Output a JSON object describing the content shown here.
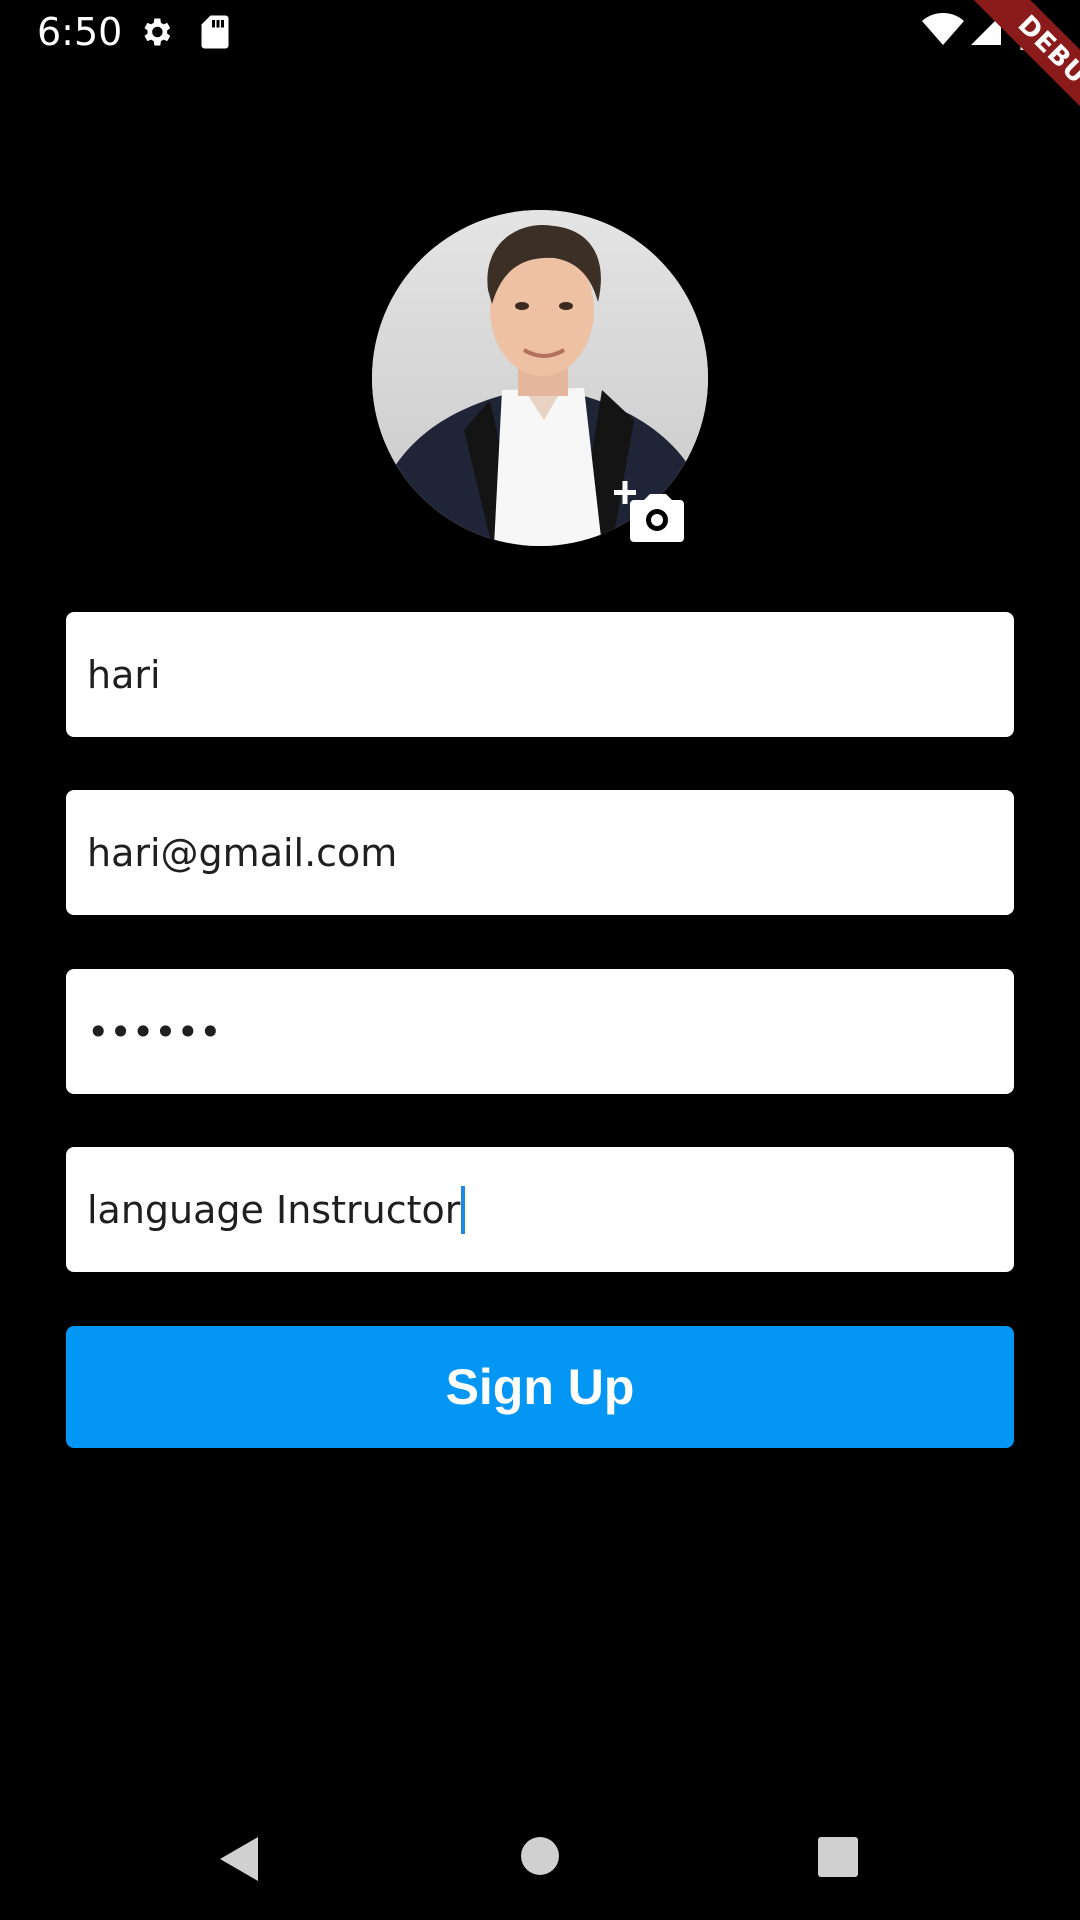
{
  "status_bar": {
    "time": "6:50",
    "icons": [
      "settings-icon",
      "sd-card-icon",
      "wifi-icon",
      "signal-icon",
      "battery-icon"
    ]
  },
  "debug_banner": "DEBUG",
  "avatar": {
    "icon": "profile-photo",
    "action_icon": "add-photo-icon"
  },
  "form": {
    "name": {
      "value": "hari"
    },
    "email": {
      "value": "hari@gmail.com"
    },
    "password": {
      "value": "••••••"
    },
    "bio": {
      "value": "language Instructor"
    }
  },
  "signup_label": "Sign Up",
  "nav_bar": {
    "icons": [
      "back-icon",
      "home-icon",
      "recents-icon"
    ]
  },
  "colors": {
    "background": "#000000",
    "field": "#ffffff",
    "button": "#0496f5",
    "debug_banner": "#8b1a1a",
    "caret": "#1e88e5"
  }
}
